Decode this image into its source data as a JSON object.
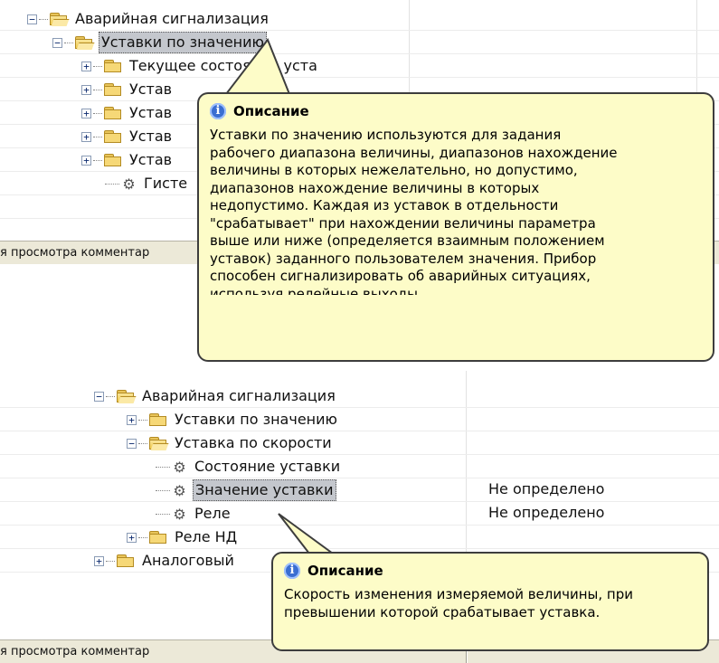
{
  "top": {
    "tree": [
      {
        "toggle": "−",
        "icon": "folder-open",
        "label": "Аварийная сигнализация"
      },
      {
        "toggle": "−",
        "icon": "folder-open",
        "label": "Уставки по значению",
        "selected": true
      },
      {
        "toggle": "+",
        "icon": "folder",
        "label": "Текущее состояние уста"
      },
      {
        "toggle": "+",
        "icon": "folder",
        "label": "Устав"
      },
      {
        "toggle": "+",
        "icon": "folder",
        "label": "Устав"
      },
      {
        "toggle": "+",
        "icon": "folder",
        "label": "Устав"
      },
      {
        "toggle": "+",
        "icon": "folder",
        "label": "Устав"
      },
      {
        "toggle": "",
        "icon": "gear",
        "label": "Гисте"
      }
    ],
    "status_text": "я просмотра комментар",
    "tooltip": {
      "icon": "info-icon",
      "title": "Описание",
      "text": "Уставки по значению используются для задания\nрабочего диапазона величины, диапазонов нахождение\nвеличины в которых нежелательно, но допустимо,\nдиапазонов нахождение величины в которых\nнедопустимо. Каждая из уставок в отдельности\n\"срабатывает\" при нахождении величины параметра\nвыше или ниже (определяется взаимным положением\nуставок) заданного пользователем значения. Прибор\nспособен сигнализировать об аварийных ситуациях,\nиспользуя релейные выходы."
    }
  },
  "bottom": {
    "tree": [
      {
        "toggle": "−",
        "icon": "folder-open",
        "label": "Аварийная сигнализация",
        "value": ""
      },
      {
        "toggle": "+",
        "icon": "folder",
        "label": "Уставки по значению",
        "value": ""
      },
      {
        "toggle": "−",
        "icon": "folder-open",
        "label": "Уставка по скорости",
        "value": ""
      },
      {
        "toggle": "",
        "icon": "gear",
        "label": "Состояние уставки",
        "value": ""
      },
      {
        "toggle": "",
        "icon": "gear",
        "label": "Значение уставки",
        "value": "Не определено",
        "selected": true
      },
      {
        "toggle": "",
        "icon": "gear",
        "label": "Реле",
        "value": "Не определено"
      },
      {
        "toggle": "+",
        "icon": "folder",
        "label": "Реле НД",
        "value": ""
      },
      {
        "toggle": "+",
        "icon": "folder",
        "label": "Аналоговый",
        "value": ""
      }
    ],
    "status_text": "я просмотра комментар",
    "tooltip": {
      "icon": "info-icon",
      "title": "Описание",
      "text": "Скорость изменения измеряемой величины, при\nпревышении которой срабатывает уставка."
    }
  },
  "colors": {
    "tooltip_bg": "#fdfcc8",
    "tooltip_border": "#3d3d3d",
    "selection": "#c4c7cd",
    "statusbar": "#ece9d8"
  }
}
